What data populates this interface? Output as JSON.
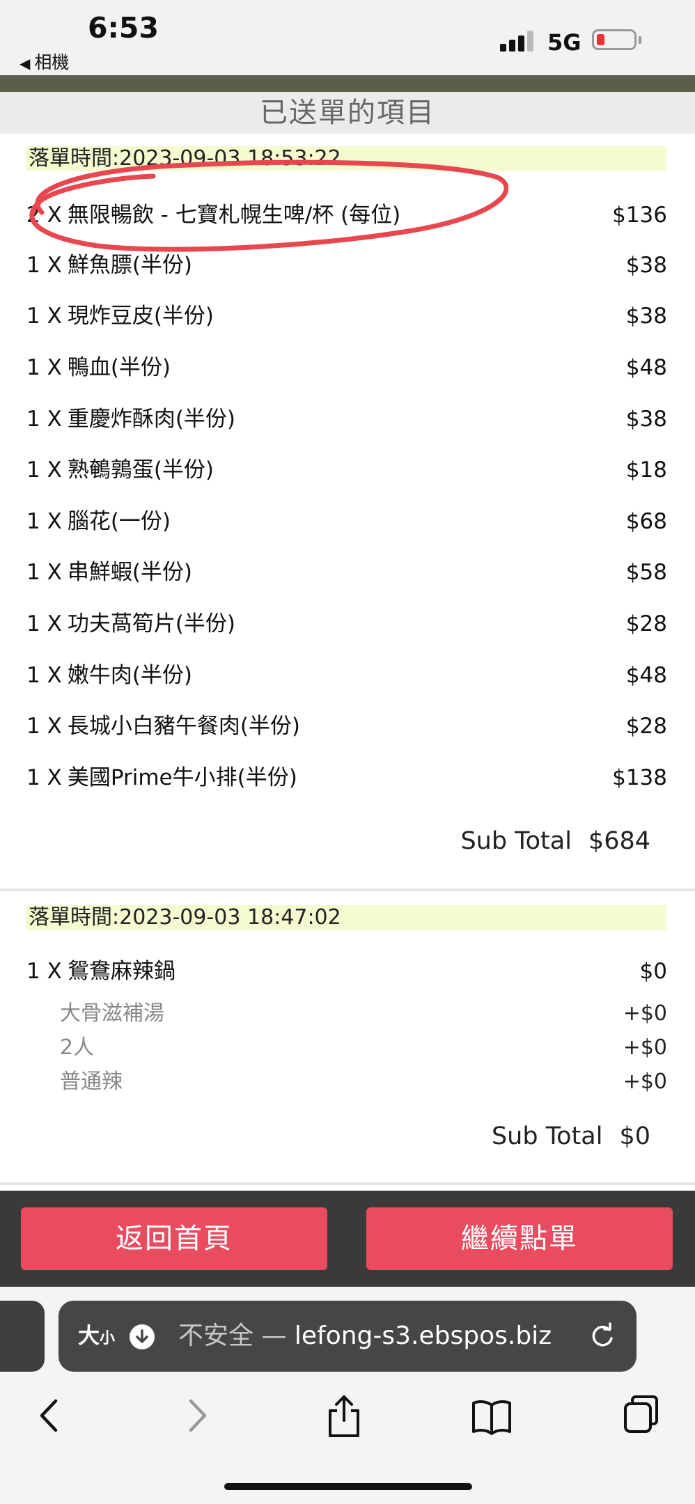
{
  "status": {
    "time": "6:53",
    "back_app": "相機",
    "network": "5G",
    "battery_color": "#e33333"
  },
  "page": {
    "title": "已送單的項目"
  },
  "orders": [
    {
      "time_label": "落單時間:",
      "time_value": "2023-09-03 18:53:22",
      "items": [
        {
          "qty": "2 X",
          "name": "無限暢飲 - 七寶札幌生啤/杯 (每位)",
          "price": "$136"
        },
        {
          "qty": "1 X",
          "name": "鮮魚膘(半份)",
          "price": "$38"
        },
        {
          "qty": "1 X",
          "name": "現炸豆皮(半份)",
          "price": "$38"
        },
        {
          "qty": "1 X",
          "name": "鴨血(半份)",
          "price": "$48"
        },
        {
          "qty": "1 X",
          "name": "重慶炸酥肉(半份)",
          "price": "$38"
        },
        {
          "qty": "1 X",
          "name": "熟鵪鶉蛋(半份)",
          "price": "$18"
        },
        {
          "qty": "1 X",
          "name": "腦花(一份)",
          "price": "$68"
        },
        {
          "qty": "1 X",
          "name": "串鮮蝦(半份)",
          "price": "$58"
        },
        {
          "qty": "1 X",
          "name": "功夫萵筍片(半份)",
          "price": "$28"
        },
        {
          "qty": "1 X",
          "name": "嫩牛肉(半份)",
          "price": "$48"
        },
        {
          "qty": "1 X",
          "name": "長城小白豬午餐肉(半份)",
          "price": "$28"
        },
        {
          "qty": "1 X",
          "name": "美國Prime牛小排(半份)",
          "price": "$138"
        }
      ],
      "subtotal_label": "Sub Total",
      "subtotal_value": "$684"
    },
    {
      "time_label": "落單時間:",
      "time_value": "2023-09-03 18:47:02",
      "items": [
        {
          "qty": "1 X",
          "name": "鴛鴦麻辣鍋",
          "price": "$0"
        }
      ],
      "modifiers": [
        {
          "name": "大骨滋補湯",
          "price": "+$0"
        },
        {
          "name": "2人",
          "price": "+$0"
        },
        {
          "name": "普通辣",
          "price": "+$0"
        }
      ],
      "subtotal_label": "Sub Total",
      "subtotal_value": "$0"
    }
  ],
  "buttons": {
    "home": "返回首頁",
    "continue": "繼續點單",
    "color": "#e94b5f"
  },
  "browser": {
    "size_label": "大",
    "size_small": "小",
    "not_secure": "不安全 — ",
    "domain": "lefong-s3.ebspos.biz",
    "icons": [
      "download-icon",
      "reload-icon",
      "back-arrow-icon",
      "forward-arrow-icon",
      "share-icon",
      "bookmarks-icon",
      "tabs-icon"
    ]
  },
  "annotation_color": "#e8474f"
}
